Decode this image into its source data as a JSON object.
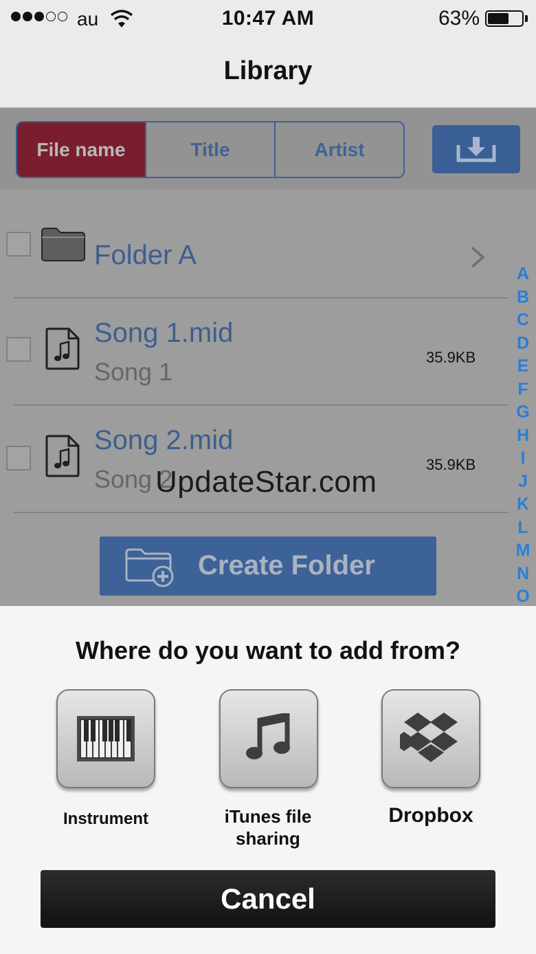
{
  "status_bar": {
    "carrier": "au",
    "time": "10:47 AM",
    "battery_percent": "63%",
    "battery_level": 0.63,
    "signal_bars": 3,
    "signal_total": 5
  },
  "nav": {
    "title": "Library"
  },
  "sort_tabs": [
    {
      "label": "File name",
      "active": true
    },
    {
      "label": "Title",
      "active": false
    },
    {
      "label": "Artist",
      "active": false
    }
  ],
  "download_button": {
    "icon": "download-tray-icon"
  },
  "list": {
    "folder": {
      "name": "Folder A",
      "icon": "folder-icon"
    },
    "songs": [
      {
        "file": "Song 1.mid",
        "title": "Song 1",
        "size": "35.9KB",
        "icon": "music-file-icon"
      },
      {
        "file": "Song 2.mid",
        "title": "Song 2",
        "size": "35.9KB",
        "icon": "music-file-icon"
      }
    ]
  },
  "index_letters": [
    "A",
    "B",
    "C",
    "D",
    "E",
    "F",
    "G",
    "H",
    "I",
    "J",
    "K",
    "L",
    "M",
    "N",
    "O"
  ],
  "create_folder": {
    "label": "Create Folder",
    "icon": "folder-add-icon"
  },
  "watermark": "UpdateStar.com",
  "sheet": {
    "title": "Where do you want to add from?",
    "sources": [
      {
        "label": "Instrument",
        "icon": "piano-keyboard-icon"
      },
      {
        "label": "iTunes file sharing",
        "icon": "music-note-icon"
      },
      {
        "label": "Dropbox",
        "icon": "dropbox-icon"
      }
    ],
    "cancel_label": "Cancel"
  },
  "colors": {
    "active_tab": "#7a1e2d",
    "accent_blue": "#3d6298",
    "index_blue": "#2a7fd4"
  }
}
